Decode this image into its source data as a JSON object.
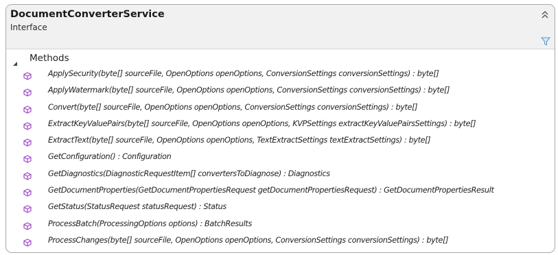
{
  "header": {
    "title": "DocumentConverterService",
    "stereotype": "Interface",
    "icons": {
      "collapse": "double-chevron-up-icon",
      "filter": "filter-icon"
    }
  },
  "section": {
    "title": "Methods",
    "expanded": true,
    "toggle_icon": "expanded-triangle-icon"
  },
  "colors": {
    "method_icon": "#a146c9",
    "filter_icon": "#5b9bd5",
    "header_bg": "#f1f1f1",
    "border": "#a8a8a8"
  },
  "methods": [
    "ApplySecurity(byte[] sourceFile, OpenOptions openOptions, ConversionSettings conversionSettings) : byte[]",
    "ApplyWatermark(byte[] sourceFile, OpenOptions openOptions, ConversionSettings conversionSettings) : byte[]",
    "Convert(byte[] sourceFile, OpenOptions openOptions, ConversionSettings conversionSettings) : byte[]",
    "ExtractKeyValuePairs(byte[] sourceFile, OpenOptions openOptions, KVPSettings extractKeyValuePairsSettings) : byte[]",
    "ExtractText(byte[] sourceFile, OpenOptions openOptions, TextExtractSettings textExtractSettings) : byte[]",
    "GetConfiguration() : Configuration",
    "GetDiagnostics(DiagnosticRequestItem[] convertersToDiagnose) : Diagnostics",
    "GetDocumentProperties(GetDocumentPropertiesRequest getDocumentPropertiesRequest) : GetDocumentPropertiesResult",
    "GetStatus(StatusRequest statusRequest) : Status",
    "ProcessBatch(ProcessingOptions options) : BatchResults",
    "ProcessChanges(byte[] sourceFile, OpenOptions openOptions, ConversionSettings conversionSettings) : byte[]"
  ]
}
